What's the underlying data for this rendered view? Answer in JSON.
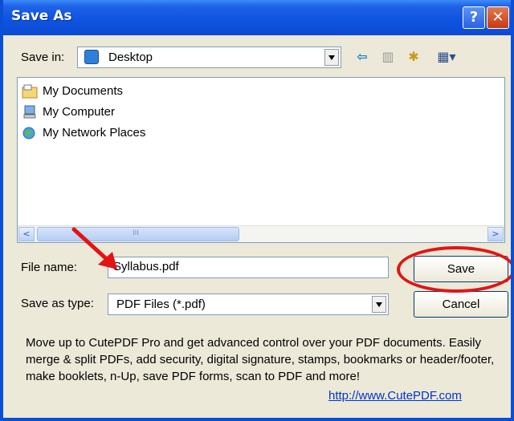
{
  "window": {
    "title": "Save As",
    "help_glyph": "?",
    "close_glyph": "✕"
  },
  "save_in": {
    "label": "Save in:",
    "value": "Desktop"
  },
  "toolbar": {
    "back_glyph": "⇦",
    "up_glyph": "▥",
    "new_folder_glyph": "✱",
    "views_glyph": "▦▾"
  },
  "file_list": {
    "items": [
      {
        "label": "My Documents",
        "icon": "my-documents-icon"
      },
      {
        "label": "My Computer",
        "icon": "my-computer-icon"
      },
      {
        "label": "My Network Places",
        "icon": "my-network-places-icon"
      }
    ],
    "scroll_left_glyph": "<",
    "scroll_right_glyph": ">",
    "scroll_grip": "III"
  },
  "file_name": {
    "label": "File name:",
    "value": "Syllabus.pdf"
  },
  "save_as_type": {
    "label": "Save as type:",
    "value": "PDF Files (*.pdf)"
  },
  "buttons": {
    "save": "Save",
    "cancel": "Cancel"
  },
  "promo": {
    "text": "Move up to CutePDF Pro and get advanced control over your PDF documents. Easily merge & split PDFs, add security, digital signature, stamps, bookmarks or header/footer, make booklets, n-Up, save PDF forms, scan to PDF and more!",
    "link": "http://www.CutePDF.com"
  },
  "colors": {
    "titlebar": "#0f54e0",
    "dialog_bg": "#ece9d8",
    "annotation_red": "#e21414",
    "link": "#0033cc"
  }
}
